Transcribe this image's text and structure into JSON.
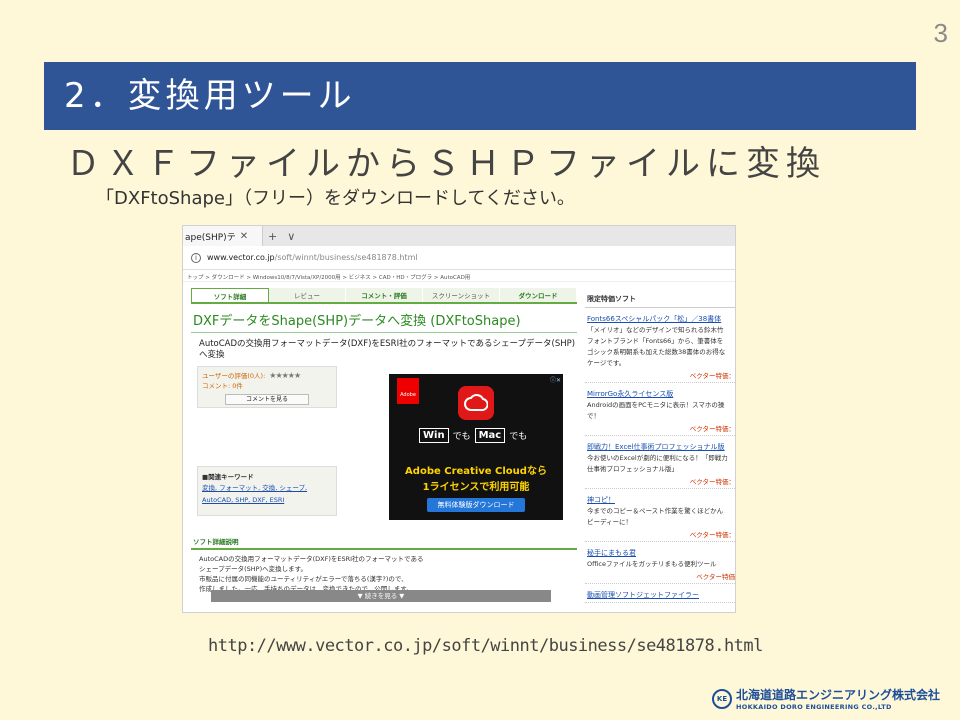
{
  "page_number": "3",
  "title": "2．変換用ツール",
  "subtitle": "ＤＸＦファイルからＳＨＰファイルに変換",
  "instruction": "「DXFtoShape」（フリー）をダウンロードしてください。",
  "url_caption": "http://www.vector.co.jp/soft/winnt/business/se481878.html",
  "browser": {
    "tab_title": "ape(SHP)テ",
    "tab_close": "✕",
    "tab_new": "+",
    "tab_menu": "∨",
    "address_host": "www.vector.co.jp",
    "address_path": "/soft/winnt/business/se481878.html",
    "breadcrumb": "トップ > ダウンロード > Windows10/8/7/Vista/XP/2000用 > ビジネス > CAD・HD・プログラ > AutoCAD用",
    "site_tabs": [
      "ソフト詳細",
      "レビュー",
      "コメント・評価",
      "スクリーンショット",
      "ダウンロード"
    ],
    "heading": "DXFデータをShape(SHP)データへ変換 (DXFtoShape)",
    "description": "AutoCADの交換用フォーマットデータ(DXF)をESRI社のフォーマットであるシェープデータ(SHP)へ変換",
    "rating_label": "ユーザーの評価(0人):",
    "stars": "★★★★★",
    "comment_count": "コメント: 0件",
    "comment_button": "コメントを見る",
    "keyword_title": "■関連キーワード",
    "keywords_line1": "変換, フォーマット, 交換, シェープ,",
    "keywords_line2": "AutoCAD, SHP, DXF, ESRI",
    "ad": {
      "corner": "ⓘ✕",
      "adobe": "Adobe",
      "win": "Win",
      "de": "でも",
      "mac": "Mac",
      "line1": "Adobe Creative Cloudなら",
      "line2": "1ライセンスで利用可能",
      "button": "無料体験版ダウンロード"
    },
    "detail_title": "ソフト詳細説明",
    "detail_lines": [
      "AutoCADの交換用フォーマットデータ(DXF)をESRI社のフォーマットである",
      "シェープデータ(SHP)へ変換します。",
      "市販品に付属の同機能のユーティリティがエラーで落ちる(漢字?)ので、",
      "作成しました。一応、手持ちのデータは、変換できたので、公開します。"
    ],
    "more_button": "▼ 続きを見る ▼",
    "sidebar_title": "限定特価ソフト",
    "sidebar_items": [
      {
        "link": "Fonts66スペシャルパック「松」／38書体",
        "lines": [
          "「メイリオ」などのデザインで知られる鈴木竹",
          "フォントブランド「Fonts66」から、筆書体を",
          "ゴシック系明朝系も加えた総数38書体のお得な",
          "ケージです。"
        ],
        "vendor": "ベクター特価："
      },
      {
        "link": "MirrorGo永久ライセンス版",
        "lines": [
          "Androidの画面をPCモニタに表示！スマホの操",
          "で！"
        ],
        "vendor": "ベクター特価："
      },
      {
        "link": "即戦力！Excel仕事術プロフェッショナル版",
        "lines": [
          "今お使いのExcelが劇的に便利になる！「即戦力",
          "仕事術プロフェッショナル版」"
        ],
        "vendor": "ベクター特価："
      },
      {
        "link": "神コピ！",
        "lines": [
          "今までのコピー＆ペースト作業を驚くほどかん",
          "ピーディーに！"
        ],
        "vendor": "ベクター特価："
      },
      {
        "link": "秘手にまもる君",
        "lines": [
          "Officeファイルをガッチリまもる便利ツール"
        ],
        "vendor": "ベクター特価"
      },
      {
        "link": "動画管理ソフトジェットファイラー",
        "lines": [],
        "vendor": ""
      }
    ]
  },
  "logo": {
    "mark": "KE",
    "ja": "北海道道路エンジニアリング株式会社",
    "en": "HOKKAIDO DORO ENGINEERING CO.,LTD"
  },
  "colors": {
    "background": "#fef8d8",
    "title_bar": "#2f5597",
    "vector_green": "#2a8a20",
    "logo_blue": "#1d4e9a"
  }
}
